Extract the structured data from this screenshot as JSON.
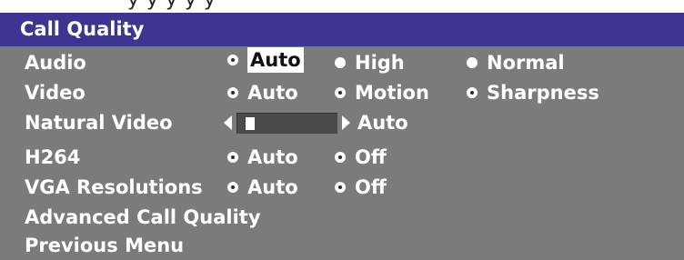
{
  "top_ghost_text": "y    y    y                              y y",
  "title": "Call Quality",
  "rows": {
    "audio": {
      "label": "Audio",
      "options": [
        "Auto",
        "High",
        "Normal"
      ],
      "selected": "Auto"
    },
    "video": {
      "label": "Video",
      "options": [
        "Auto",
        "Motion",
        "Sharpness"
      ],
      "selected": "Auto"
    },
    "natural_video": {
      "label": "Natural Video",
      "value_label": "Auto",
      "level": 0.05
    },
    "h264": {
      "label": "H264",
      "options": [
        "Auto",
        "Off"
      ],
      "selected": "Auto"
    },
    "vga": {
      "label": "VGA Resolutions",
      "options": [
        "Auto",
        "Off"
      ],
      "selected": "Auto"
    }
  },
  "advanced_label": "Advanced Call Quality",
  "previous_label": "Previous Menu",
  "colors": {
    "title_bg": "#3d3591",
    "panel_bg": "#7b7b7b",
    "text": "#ffffff",
    "focus_bg": "#ffffff",
    "focus_text": "#111111"
  }
}
